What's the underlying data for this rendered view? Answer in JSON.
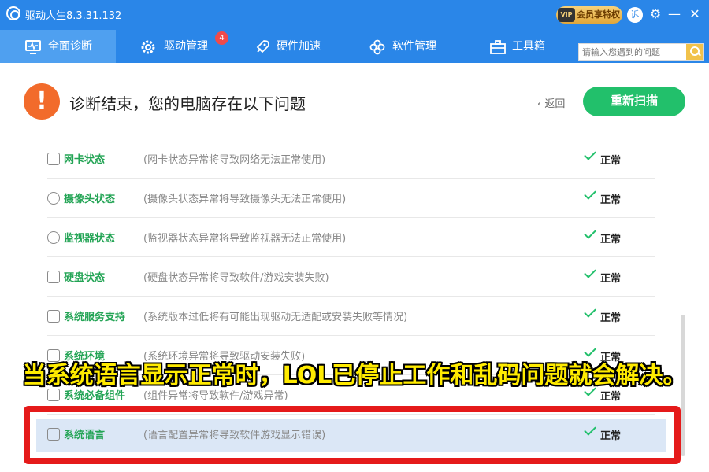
{
  "window": {
    "title": "驱动人生8.3.31.132",
    "vip_label": "会员享特权",
    "vip_badge": "VIP",
    "avatar_text": "诉"
  },
  "nav": {
    "tabs": [
      {
        "label": "全面诊断",
        "icon": "monitor-icon"
      },
      {
        "label": "驱动管理",
        "icon": "gear-icon",
        "badge": "4"
      },
      {
        "label": "硬件加速",
        "icon": "rocket-icon"
      },
      {
        "label": "软件管理",
        "icon": "flower-icon"
      },
      {
        "label": "工具箱",
        "icon": "toolbox-icon"
      }
    ],
    "search_placeholder": "请输入您遇到的问题"
  },
  "header": {
    "title": "诊断结束，您的电脑存在以下问题",
    "back_label": "返回",
    "rescan_label": "重新扫描",
    "alert_glyph": "!"
  },
  "items": [
    {
      "name": "网卡状态",
      "desc": "(网卡状态异常将导致网络无法正常使用)",
      "status": "正常"
    },
    {
      "name": "摄像头状态",
      "desc": "(摄像头状态异常将导致摄像头无法正常使用)",
      "status": "正常"
    },
    {
      "name": "监视器状态",
      "desc": "(监视器状态异常将导致监视器无法正常使用)",
      "status": "正常"
    },
    {
      "name": "硬盘状态",
      "desc": "(硬盘状态异常将导致软件/游戏安装失败)",
      "status": "正常"
    },
    {
      "name": "系统服务支持",
      "desc": "(系统版本过低将有可能出现驱动无适配或安装失败等情况)",
      "status": "正常"
    },
    {
      "name": "系统环境",
      "desc": "(系统环境异常将导致驱动安装失败)",
      "status": "正常"
    },
    {
      "name": "系统必备组件",
      "desc": "(组件异常将导致软件/游戏异常)",
      "status": "正常"
    },
    {
      "name": "系统语言",
      "desc": "(语言配置异常将导致软件游戏显示错误)",
      "status": "正常"
    }
  ],
  "caption": "当系统语言显示正常时，LOL已停止工作和乱码问题就会解决。"
}
